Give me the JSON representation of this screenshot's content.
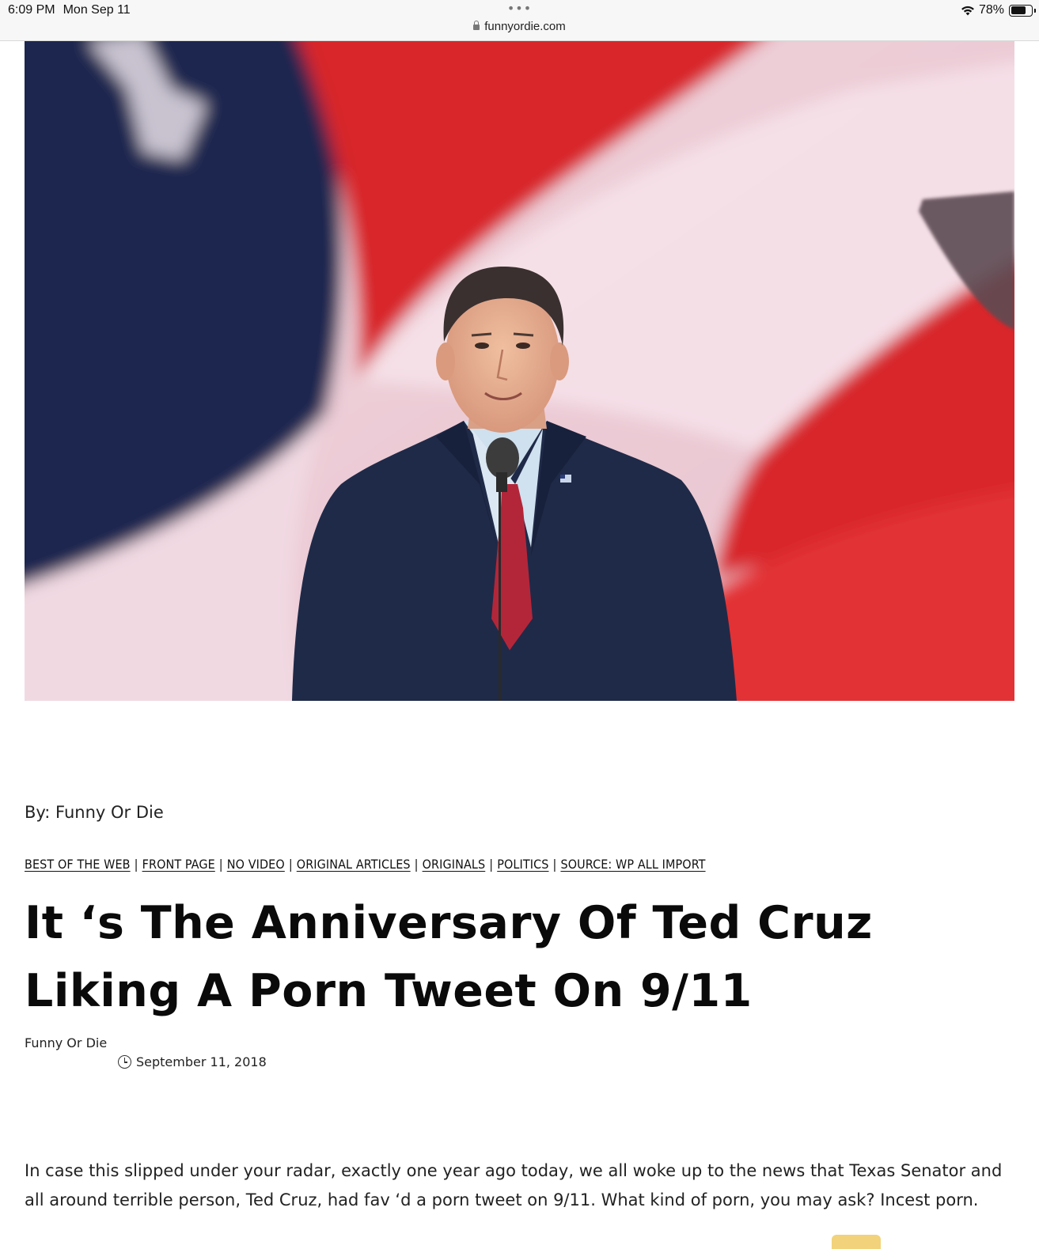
{
  "status_bar": {
    "time": "6:09 PM",
    "date": "Mon Sep 11",
    "tab_dots": "•••",
    "url": "funnyordie.com",
    "battery_percent": "78%",
    "battery_level": 0.78,
    "icons": [
      "lock-icon",
      "wifi-icon",
      "battery-icon"
    ]
  },
  "hero": {
    "description_icon": "hero-photo"
  },
  "article": {
    "byline": "By: Funny Or Die",
    "categories": [
      "BEST OF THE WEB",
      "FRONT PAGE",
      "NO VIDEO",
      "ORIGINAL ARTICLES",
      "ORIGINALS",
      "POLITICS",
      "SOURCE: WP ALL IMPORT"
    ],
    "category_separator": "|",
    "headline_line1": "It ‘s The Anniversary Of Ted Cruz",
    "headline_line2": "Liking A Porn Tweet On 9/11",
    "author": "Funny Or Die",
    "date": "September 11, 2018",
    "body": "In case this slipped under your radar, exactly one year ago today, we all woke up to the news that Texas Senator and all around terrible person, Ted Cruz, had fav ‘d a porn tweet on 9/11. What kind of porn, you may ask? Incest porn."
  },
  "colors": {
    "flag_red": "#d8262a",
    "flag_blue": "#1c2550",
    "flag_white": "#f3d6e0",
    "suit_navy": "#1f2a48",
    "tie_red": "#b3263a",
    "badge_yellow": "#f2d27a"
  }
}
